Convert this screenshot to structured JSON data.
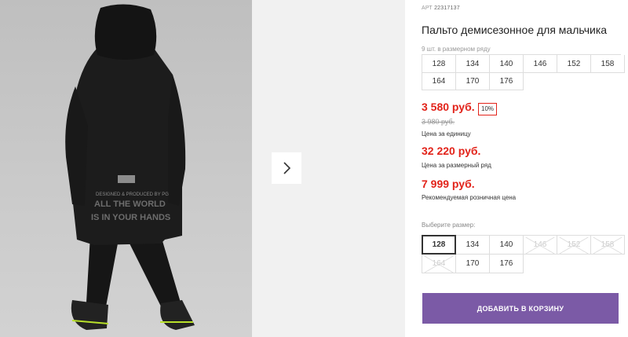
{
  "gallery": {
    "print_text_line1": "DESIGNED & PRODUCED BY PG",
    "print_text_line2": "ALL THE WORLD",
    "print_text_line3": "IS IN YOUR HANDS",
    "next_icon": "chevron-right-icon"
  },
  "product": {
    "art_label": "АРТ",
    "art_number": "22317137",
    "title": "Пальто демисезонное для мальчика",
    "size_row_note": "9 шт. в размерном ряду",
    "size_row": [
      "128",
      "134",
      "140",
      "146",
      "152",
      "158",
      "164",
      "170",
      "176"
    ]
  },
  "prices": {
    "unit_price": "3 580 руб.",
    "discount": "10%",
    "old_price": "3 980 руб.",
    "unit_caption": "Цена за единицу",
    "row_price": "32 220 руб.",
    "row_caption": "Цена за размерный ряд",
    "retail_price": "7 999 руб.",
    "retail_caption": "Рекомендуемая розничная цена"
  },
  "size_select": {
    "label": "Выберите размер:",
    "options": [
      {
        "value": "128",
        "state": "selected"
      },
      {
        "value": "134",
        "state": "available"
      },
      {
        "value": "140",
        "state": "available"
      },
      {
        "value": "146",
        "state": "disabled"
      },
      {
        "value": "152",
        "state": "disabled"
      },
      {
        "value": "158",
        "state": "disabled"
      },
      {
        "value": "164",
        "state": "disabled"
      },
      {
        "value": "170",
        "state": "available"
      },
      {
        "value": "176",
        "state": "available"
      }
    ]
  },
  "cart": {
    "button_label": "ДОБАВИТЬ В КОРЗИНУ"
  },
  "colors": {
    "accent": "#7b5aa6",
    "price_red": "#e2231a"
  }
}
